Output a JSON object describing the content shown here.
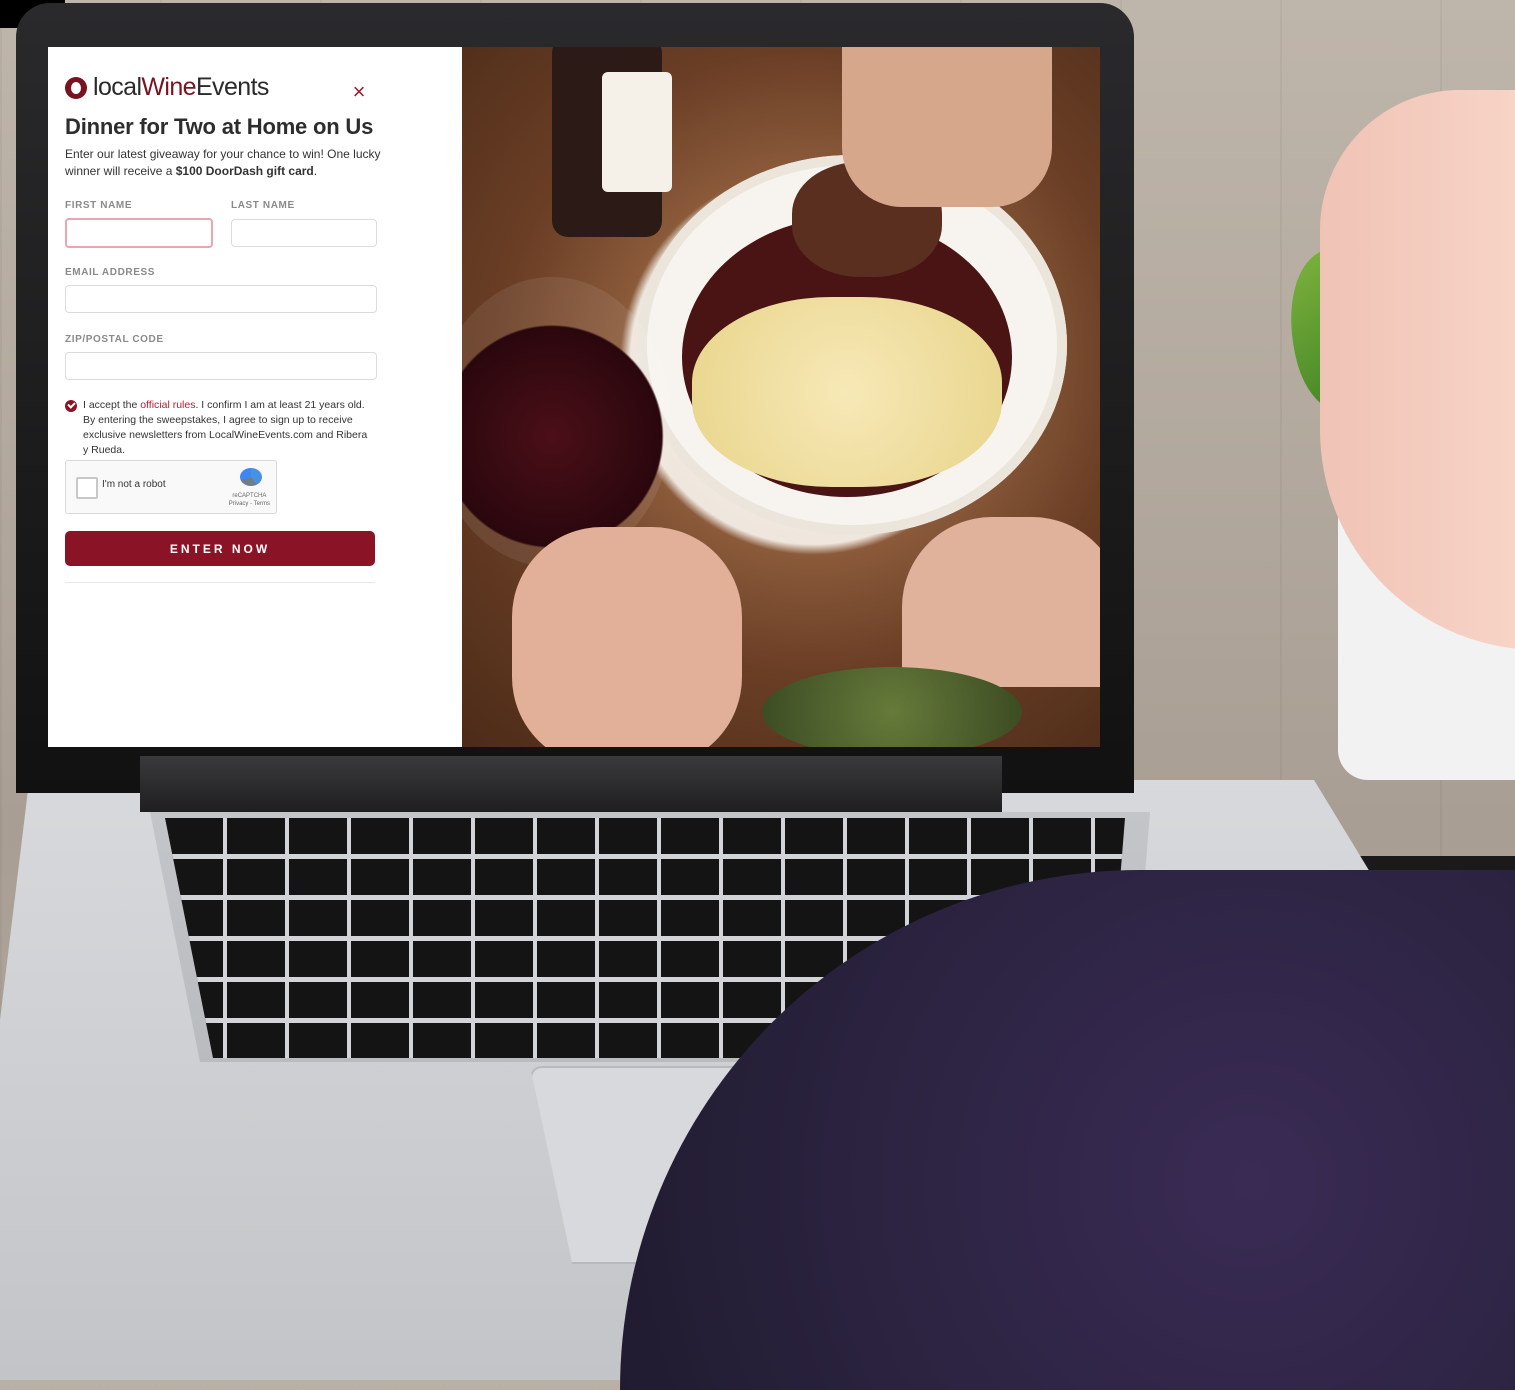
{
  "brand": {
    "logo_prefix": "local",
    "logo_wine": "Wine",
    "logo_suffix": "Events"
  },
  "modal": {
    "title": "Dinner for Two at Home on Us",
    "description_prefix": "Enter our latest giveaway for your chance to win! One lucky winner will receive a ",
    "description_bold": "$100 DoorDash gift card",
    "description_suffix": ".",
    "close_icon": "×"
  },
  "form": {
    "first_name_label": "FIRST NAME",
    "last_name_label": "LAST NAME",
    "email_label": "EMAIL ADDRESS",
    "zip_label": "ZIP/POSTAL CODE",
    "first_name_value": "",
    "last_name_value": "",
    "email_value": "",
    "zip_value": "",
    "consent_prefix": "I accept the ",
    "consent_link": "official rules",
    "consent_suffix": ". I confirm I am at least 21 years old. By entering the sweepstakes, I agree to sign up to receive exclusive newsletters from LocalWineEvents.com and Ribera y Rueda.",
    "captcha_label": "I'm not a robot",
    "captcha_brand": "reCAPTCHA",
    "captcha_footer": "Privacy - Terms",
    "submit_label": "ENTER NOW"
  },
  "colors": {
    "brand_red": "#8b1326",
    "active_input_border": "#e7a6b0"
  },
  "icons": {
    "logo": "logo-icon",
    "close": "close-icon",
    "consent_check": "check-circle-icon",
    "captcha": "recaptcha-icon"
  }
}
